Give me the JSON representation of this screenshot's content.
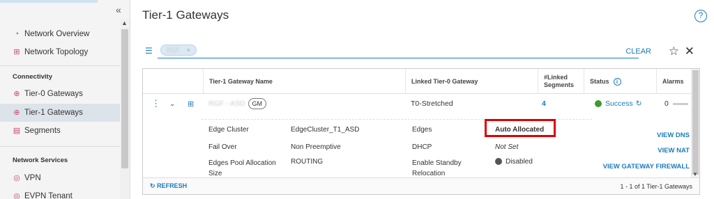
{
  "sidebar": {
    "items": [
      {
        "label": "Network Overview",
        "icon": "gauge-icon"
      },
      {
        "label": "Network Topology",
        "icon": "topology-icon"
      },
      {
        "label": "Tier-0 Gateways",
        "icon": "gateway-icon"
      },
      {
        "label": "Tier-1 Gateways",
        "icon": "gateway-icon"
      },
      {
        "label": "Segments",
        "icon": "segments-icon"
      },
      {
        "label": "VPN",
        "icon": "vpn-icon"
      },
      {
        "label": "EVPN Tenant",
        "icon": "evpn-icon"
      }
    ],
    "sections": {
      "connectivity": "Connectivity",
      "network_services": "Network Services"
    },
    "collapse_glyph": "«"
  },
  "header": {
    "title": "Tier-1 Gateways",
    "help": "?"
  },
  "filter": {
    "chip_text": "RGF",
    "chip_close": "×",
    "clear_label": "CLEAR"
  },
  "table": {
    "columns": [
      "Tier-1 Gateway Name",
      "Linked Tier-0 Gateway",
      "#Linked Segments",
      "Status",
      "Alarms"
    ],
    "row": {
      "name": "RGF - ASD",
      "tag": "GM",
      "linked_t0": "T0-Stretched",
      "segments": "4",
      "status": "Success",
      "alarms": "0"
    },
    "details": {
      "edge_cluster_label": "Edge Cluster",
      "edge_cluster_value": "EdgeCluster_T1_ASD",
      "failover_label": "Fail Over",
      "failover_value": "Non Preemptive",
      "pool_label": "Edges Pool Allocation Size",
      "pool_value": "ROUTING",
      "edges_label": "Edges",
      "edges_value": "Auto Allocated",
      "dhcp_label": "DHCP",
      "dhcp_value": "Not Set",
      "standby_label": "Enable Standby Relocation",
      "standby_value": "Disabled"
    },
    "actions": {
      "dns": "VIEW DNS",
      "nat": "VIEW NAT",
      "firewall": "VIEW GATEWAY FIREWALL"
    },
    "footer": {
      "refresh": "REFRESH",
      "pager": "1 - 1 of 1 Tier-1 Gateways"
    }
  },
  "colors": {
    "accent": "#1a7bbf",
    "success": "#3e9b2e",
    "highlight": "#e00000"
  }
}
